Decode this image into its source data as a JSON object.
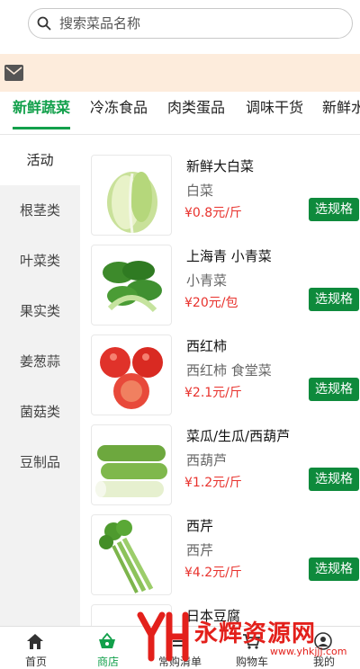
{
  "search": {
    "placeholder": "搜索菜品名称"
  },
  "categories": [
    {
      "label": "新鲜蔬菜",
      "active": true
    },
    {
      "label": "冷冻食品"
    },
    {
      "label": "肉类蛋品"
    },
    {
      "label": "调味干货"
    },
    {
      "label": "新鲜水"
    }
  ],
  "sidebar": [
    {
      "label": "活动",
      "active": true
    },
    {
      "label": "根茎类"
    },
    {
      "label": "叶菜类"
    },
    {
      "label": "果实类"
    },
    {
      "label": "姜葱蒜"
    },
    {
      "label": "菌菇类"
    },
    {
      "label": "豆制品"
    }
  ],
  "products": [
    {
      "name": "新鲜大白菜",
      "sub": "白菜",
      "price": "¥0.8元/斤",
      "button": "选规格",
      "image_icon": "napa-cabbage-image"
    },
    {
      "name": "上海青 小青菜",
      "sub": "小青菜",
      "price": "¥20元/包",
      "button": "选规格",
      "image_icon": "bok-choy-image"
    },
    {
      "name": "西红柿",
      "sub": "西红柿 食堂菜",
      "price": "¥2.1元/斤",
      "button": "选规格",
      "image_icon": "tomato-image"
    },
    {
      "name": "菜瓜/生瓜/西葫芦",
      "sub": "西葫芦",
      "price": "¥1.2元/斤",
      "button": "选规格",
      "image_icon": "zucchini-image"
    },
    {
      "name": "西芹",
      "sub": "西芹",
      "price": "¥4.2元/斤",
      "button": "选规格",
      "image_icon": "celery-image"
    },
    {
      "name": "日本豆腐",
      "sub": "",
      "price": "",
      "button": "",
      "image_icon": "tofu-image"
    }
  ],
  "bottom_nav": [
    {
      "label": "首页",
      "icon": "home-icon"
    },
    {
      "label": "商店",
      "icon": "basket-icon",
      "active": true
    },
    {
      "label": "常购清单",
      "icon": "list-icon"
    },
    {
      "label": "购物车",
      "icon": "cart-icon"
    },
    {
      "label": "我的",
      "icon": "user-icon"
    }
  ],
  "watermark": {
    "text": "永辉资源网",
    "url": "www.yhkjjj.com"
  },
  "colors": {
    "accent": "#12a04b",
    "button": "#0e8a3c",
    "price": "#e8322d",
    "notice_bg": "#fdecdc"
  }
}
